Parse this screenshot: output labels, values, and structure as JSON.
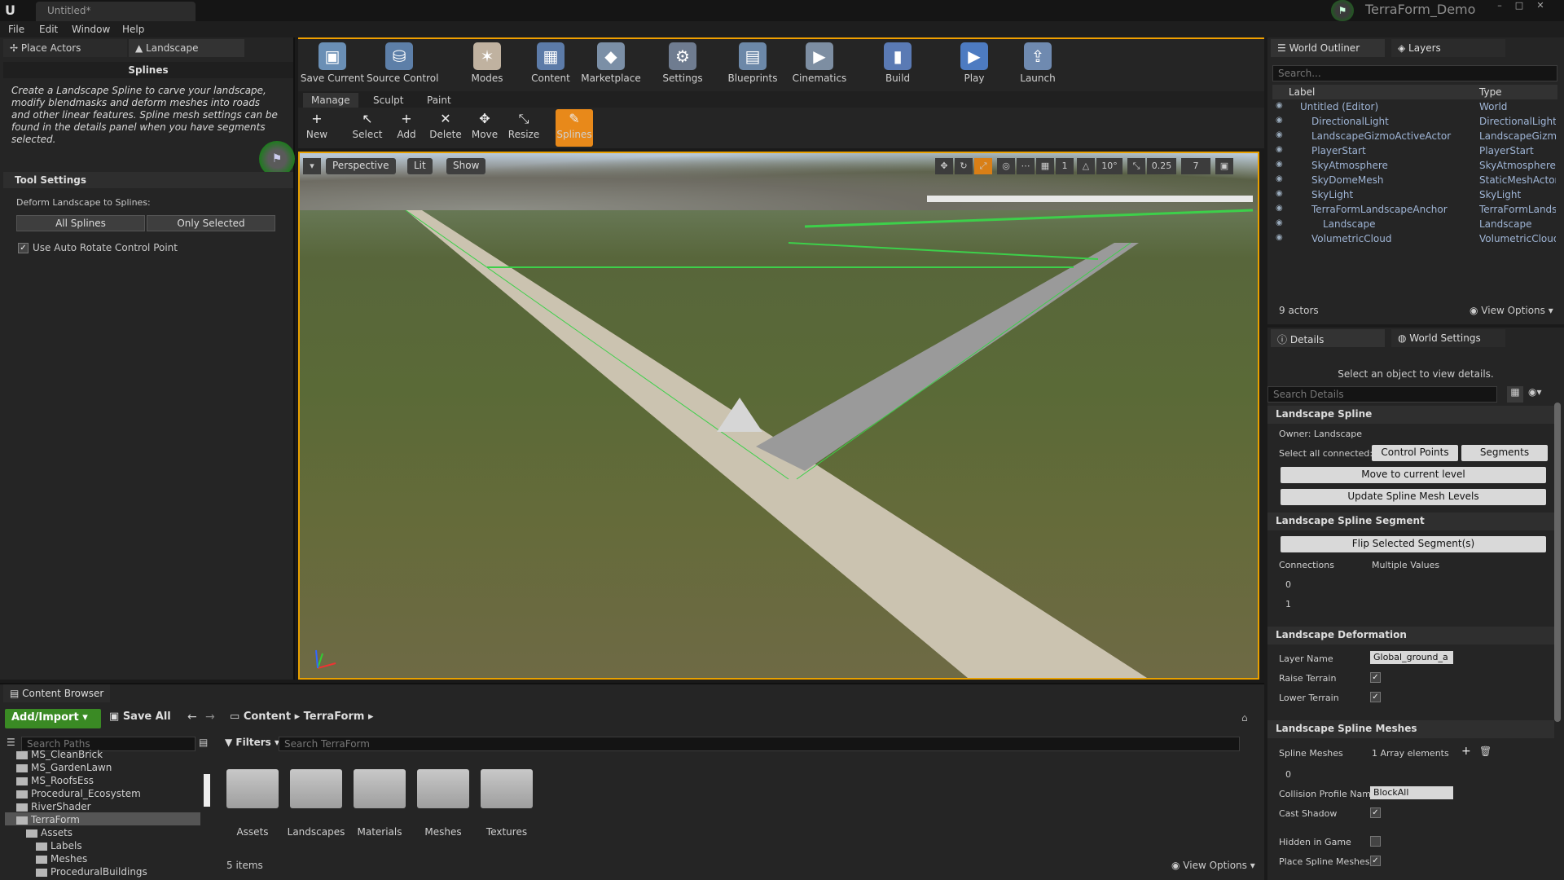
{
  "title_bar": {
    "doc_tab": "Untitled*",
    "project": "TerraForm_Demo"
  },
  "menu": [
    "File",
    "Edit",
    "Window",
    "Help"
  ],
  "left_panel": {
    "tabs": [
      "Place Actors",
      "Landscape"
    ],
    "section_title": "Splines",
    "description": "Create a Landscape Spline to carve your landscape, modify blendmasks and deform meshes into roads and other linear features.  Spline mesh settings can be found in the details panel when you have segments selected.",
    "tool_settings_title": "Tool Settings",
    "deform_label": "Deform Landscape to Splines:",
    "all_splines": "All Splines",
    "only_selected": "Only Selected",
    "auto_rotate_label": "Use Auto Rotate Control Point"
  },
  "toolbar": [
    {
      "label": "Save Current",
      "icon": "save-icon",
      "color": "#6a8fb5"
    },
    {
      "label": "Source Control",
      "icon": "source-control-icon",
      "color": "#5d7fa8"
    },
    {
      "label": "Modes",
      "icon": "modes-icon",
      "color": "#c0b2a0"
    },
    {
      "label": "Content",
      "icon": "content-icon",
      "color": "#5c7ba8"
    },
    {
      "label": "Marketplace",
      "icon": "marketplace-icon",
      "color": "#7b8fa6"
    },
    {
      "label": "Settings",
      "icon": "settings-icon",
      "color": "#6f7c90"
    },
    {
      "label": "Blueprints",
      "icon": "blueprints-icon",
      "color": "#6c88a8"
    },
    {
      "label": "Cinematics",
      "icon": "cinematics-icon",
      "color": "#7d8ea2"
    },
    {
      "label": "Build",
      "icon": "build-icon",
      "color": "#5a7ab4"
    },
    {
      "label": "Play",
      "icon": "play-icon",
      "color": "#4d7bc1"
    },
    {
      "label": "Launch",
      "icon": "launch-icon",
      "color": "#6f8ab0"
    }
  ],
  "mode_tabs": [
    "Manage",
    "Sculpt",
    "Paint"
  ],
  "mode_tools": [
    "New",
    "Select",
    "Add",
    "Delete",
    "Move",
    "Resize",
    "Splines"
  ],
  "viewport": {
    "perspective": "Perspective",
    "lit": "Lit",
    "show": "Show",
    "angle": "10°",
    "scale": "0.25",
    "speed": "7"
  },
  "outliner": {
    "tabs": [
      "World Outliner",
      "Layers"
    ],
    "search_placeholder": "Search...",
    "col_label": "Label",
    "col_type": "Type",
    "rows": [
      {
        "label": "Untitled (Editor)",
        "type": "World",
        "indent": 1
      },
      {
        "label": "DirectionalLight",
        "type": "DirectionalLight",
        "indent": 2
      },
      {
        "label": "LandscapeGizmoActiveActor",
        "type": "LandscapeGizmo",
        "indent": 2
      },
      {
        "label": "PlayerStart",
        "type": "PlayerStart",
        "indent": 2
      },
      {
        "label": "SkyAtmosphere",
        "type": "SkyAtmosphere",
        "indent": 2
      },
      {
        "label": "SkyDomeMesh",
        "type": "StaticMeshActor",
        "indent": 2
      },
      {
        "label": "SkyLight",
        "type": "SkyLight",
        "indent": 2
      },
      {
        "label": "TerraFormLandscapeAnchor",
        "type": "TerraFormLandsc",
        "indent": 2
      },
      {
        "label": "Landscape",
        "type": "Landscape",
        "indent": 3
      },
      {
        "label": "VolumetricCloud",
        "type": "VolumetricCloud",
        "indent": 2
      }
    ],
    "count": "9 actors",
    "view_options": "View Options"
  },
  "details": {
    "tabs": [
      "Details",
      "World Settings"
    ],
    "message": "Select an object to view details.",
    "search_placeholder": "Search Details",
    "landscape_spline": "Landscape Spline",
    "owner": "Owner: Landscape",
    "select_all_connected": "Select all connected:",
    "control_points": "Control Points",
    "segments": "Segments",
    "move_to_level": "Move to current level",
    "update_levels": "Update Spline Mesh Levels",
    "segment_title": "Landscape Spline Segment",
    "flip": "Flip Selected Segment(s)",
    "connections": "Connections",
    "multiple_values": "Multiple Values",
    "conn_0": "0",
    "conn_1": "1",
    "deformation_title": "Landscape Deformation",
    "layer_name_label": "Layer Name",
    "layer_name_value": "Global_ground_a",
    "raise_terrain": "Raise Terrain",
    "lower_terrain": "Lower Terrain",
    "meshes_title": "Landscape Spline Meshes",
    "spline_meshes": "Spline Meshes",
    "array_elements": "1 Array elements",
    "mesh_0": "0",
    "collision_label": "Collision Profile Nam",
    "collision_value": "BlockAll",
    "cast_shadow": "Cast Shadow",
    "hidden_in_game": "Hidden in Game",
    "place_spline_meshes": "Place Spline Meshes"
  },
  "content_browser": {
    "tab": "Content Browser",
    "add_import": "Add/Import",
    "save_all": "Save All",
    "path": [
      "Content",
      "TerraForm"
    ],
    "search_paths": "Search Paths",
    "filters": "Filters",
    "search_placeholder": "Search TerraForm",
    "tree": [
      {
        "label": "MS_CleanBrick",
        "indent": 0
      },
      {
        "label": "MS_GardenLawn",
        "indent": 0
      },
      {
        "label": "MS_RoofsEss",
        "indent": 0
      },
      {
        "label": "Procedural_Ecosystem",
        "indent": 0
      },
      {
        "label": "RiverShader",
        "indent": 0
      },
      {
        "label": "TerraForm",
        "indent": 0
      },
      {
        "label": "Assets",
        "indent": 1
      },
      {
        "label": "Labels",
        "indent": 2
      },
      {
        "label": "Meshes",
        "indent": 2
      },
      {
        "label": "ProceduralBuildings",
        "indent": 2
      }
    ],
    "folders": [
      "Assets",
      "Landscapes",
      "Materials",
      "Meshes",
      "Textures"
    ],
    "items": "5 items",
    "view_options": "View Options"
  }
}
